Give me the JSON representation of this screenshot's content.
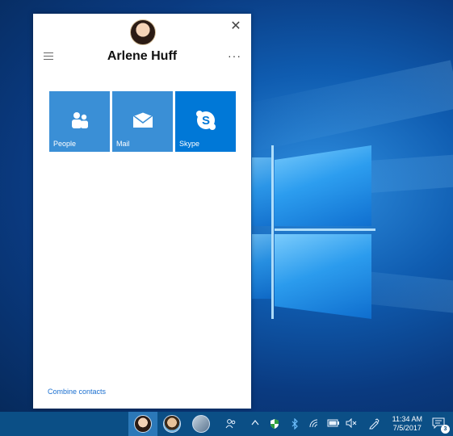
{
  "flyout": {
    "contact_name": "Arlene Huff",
    "more_label": "···",
    "close_label": "✕",
    "tiles": [
      {
        "label": "People",
        "icon": "people-icon"
      },
      {
        "label": "Mail",
        "icon": "mail-icon"
      },
      {
        "label": "Skype",
        "icon": "skype-icon"
      }
    ],
    "combine_link": "Combine contacts"
  },
  "taskbar": {
    "pinned_contacts": [
      "contact-avatar-arlene",
      "contact-avatar-2",
      "contact-avatar-group"
    ],
    "tray_icons": [
      "people-icon",
      "chevron-up-icon",
      "security-shield-icon",
      "bluetooth-icon",
      "wifi-icon",
      "battery-icon",
      "volume-muted-icon",
      "pen-icon"
    ],
    "time": "11:34 AM",
    "date": "7/5/2017",
    "notification_count": "3"
  },
  "colors": {
    "tile_blue": "#3a8fd6",
    "skype_blue": "#0078d7",
    "taskbar": "#0b4f86",
    "link": "#1a6fd0"
  }
}
